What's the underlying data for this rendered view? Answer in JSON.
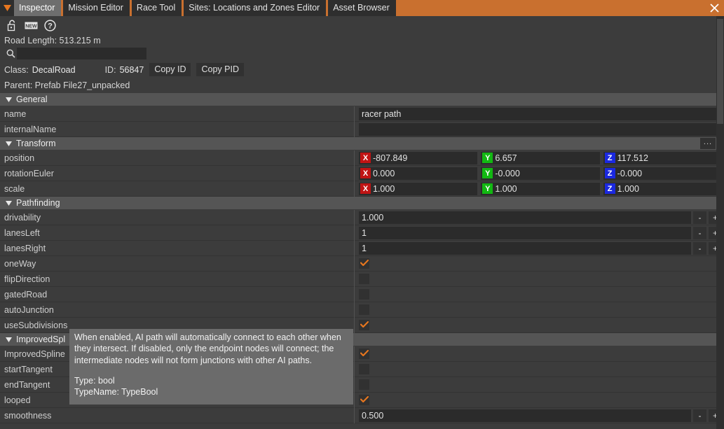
{
  "tabbar": {
    "caret_icon": "caret-down-icon",
    "close_icon": "close-icon",
    "tabs": [
      {
        "label": "Inspector",
        "active": true
      },
      {
        "label": "Mission Editor",
        "active": false
      },
      {
        "label": "Race Tool",
        "active": false
      },
      {
        "label": "Sites: Locations and Zones Editor",
        "active": false
      },
      {
        "label": "Asset Browser",
        "active": false
      }
    ]
  },
  "toolbar": {
    "lock_icon": "unlocked-padlock-icon",
    "new_icon": "new-badge-icon",
    "help_icon": "question-mark-icon"
  },
  "header": {
    "road_length": "Road Length: 513.215 m",
    "search_icon": "search-icon",
    "search_value": "",
    "search_placeholder": "",
    "class_label": "Class:",
    "class_value": "DecalRoad",
    "id_label": "ID:",
    "id_value": "56847",
    "copy_id_label": "Copy ID",
    "copy_pid_label": "Copy PID",
    "parent_label": "Parent:",
    "parent_value": "Prefab File27_unpacked"
  },
  "sections": {
    "general": "General",
    "transform": "Transform",
    "transform_more": "...",
    "pathfinding": "Pathfinding",
    "improvedspline": "ImprovedSpl"
  },
  "general_rows": [
    {
      "label": "name",
      "value": "racer path"
    },
    {
      "label": "internalName",
      "value": ""
    }
  ],
  "transform_rows": [
    {
      "label": "position",
      "x": "-807.849",
      "y": "6.657",
      "z": "117.512"
    },
    {
      "label": "rotationEuler",
      "x": "0.000",
      "y": "-0.000",
      "z": "-0.000"
    },
    {
      "label": "scale",
      "x": "1.000",
      "y": "1.000",
      "z": "1.000"
    }
  ],
  "axis_labels": {
    "x": "X",
    "y": "Y",
    "z": "Z"
  },
  "axis_colors": {
    "x": "#c01414",
    "y": "#12b812",
    "z": "#1a28e0"
  },
  "spinner": {
    "minus": "-",
    "plus": "+"
  },
  "accent_color": "#e8771f",
  "tabbar_color": "#c9702f",
  "pathfinding_rows": [
    {
      "label": "drivability",
      "type": "number",
      "value": "1.000"
    },
    {
      "label": "lanesLeft",
      "type": "number",
      "value": "1"
    },
    {
      "label": "lanesRight",
      "type": "number",
      "value": "1"
    },
    {
      "label": "oneWay",
      "type": "checkbox",
      "checked": true
    },
    {
      "label": "flipDirection",
      "type": "checkbox",
      "checked": false
    },
    {
      "label": "gatedRoad",
      "type": "checkbox",
      "checked": false
    },
    {
      "label": "autoJunction",
      "type": "checkbox",
      "checked": false
    },
    {
      "label": "useSubdivisions",
      "type": "checkbox",
      "checked": true
    }
  ],
  "improvedspline_rows": [
    {
      "label": "ImprovedSpline",
      "type": "checkbox",
      "checked": true
    },
    {
      "label": "startTangent",
      "type": "checkbox",
      "checked": false
    },
    {
      "label": "endTangent",
      "type": "checkbox",
      "checked": false
    },
    {
      "label": "looped",
      "type": "checkbox",
      "checked": true
    },
    {
      "label": "smoothness",
      "type": "number",
      "value": "0.500"
    }
  ],
  "tooltip": {
    "body": "When enabled, AI path will automatically connect to each other when they intersect. If disabled, only the endpoint nodes will connect; the intermediate nodes will not form junctions with other AI paths.",
    "type_line": "Type: bool",
    "typename_line": "TypeName: TypeBool"
  }
}
